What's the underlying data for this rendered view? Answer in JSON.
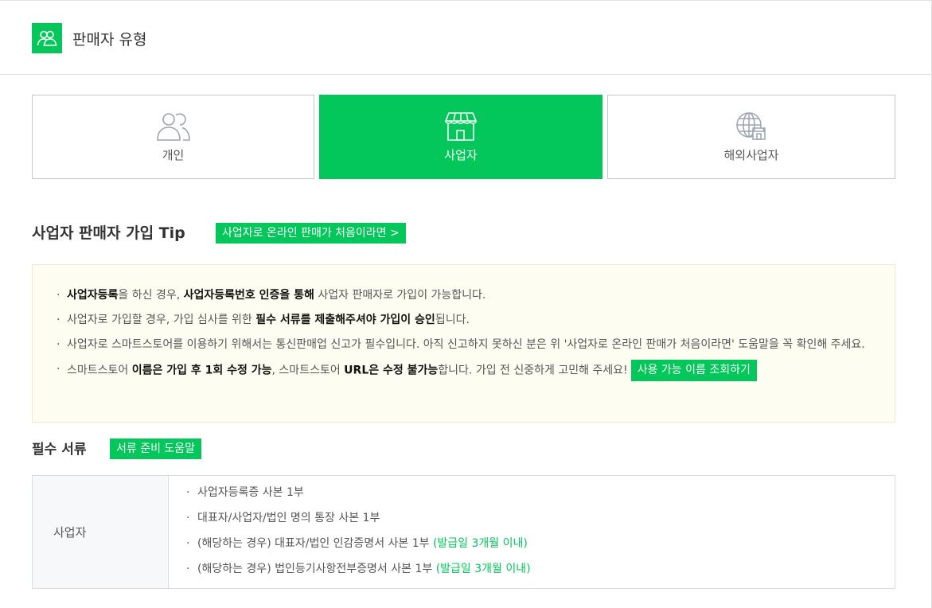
{
  "header": {
    "title": "판매자 유형",
    "icon": "people-icon"
  },
  "seller_types": [
    {
      "label": "개인",
      "icon": "person-icon",
      "selected": false
    },
    {
      "label": "사업자",
      "icon": "store-icon",
      "selected": true
    },
    {
      "label": "해외사업자",
      "icon": "globe-store-icon",
      "selected": false
    }
  ],
  "tip": {
    "title": "사업자 판매자 가입 Tip",
    "first_time_button": "사업자로 온라인 판매가 처음이라면 >",
    "items": [
      {
        "b1": "사업자등록",
        "t1": "을 하신 경우, ",
        "b2": "사업자등록번호 인증을 통해",
        "t2": " 사업자 판매자로 가입이 가능합니다."
      },
      {
        "t1": "사업자로 가입할 경우, 가입 심사를 위한 ",
        "b1": "필수 서류를 제출해주셔야 가입이 승인",
        "t2": "됩니다."
      },
      {
        "t1": "사업자로 스마트스토어를 이용하기 위해서는 통신판매업 신고가 필수입니다. 아직 신고하지 못하신 분은 위 '사업자로 온라인 판매가 처음이라면' 도움말을 꼭 확인해 주세요."
      },
      {
        "t1": "스마트스토어 ",
        "b1": "이름은 가입 후 1회 수정 가능",
        "t2": ", 스마트스토어 ",
        "b2": "URL은 수정 불가능",
        "t3": "합니다. 가입 전 신중하게 고민해 주세요!",
        "button": "사용 가능 이름 조회하기"
      }
    ]
  },
  "documents": {
    "title": "필수 서류",
    "help_button": "서류 준비 도움말",
    "row_header": "사업자",
    "items": [
      {
        "text": "사업자등록증 사본 1부",
        "note": ""
      },
      {
        "text": "대표자/사업자/법인 명의 통장 사본 1부",
        "note": ""
      },
      {
        "text": "(해당하는 경우) 대표자/법인 인감증명서 사본 1부 ",
        "note": "(발급일 3개월 이내)"
      },
      {
        "text": "(해당하는 경우) 법인등기사항전부증명서 사본 1부 ",
        "note": "(발급일 3개월 이내)"
      }
    ]
  },
  "colors": {
    "accent": "#03c75a",
    "tip_bg": "#fdfdf2"
  }
}
